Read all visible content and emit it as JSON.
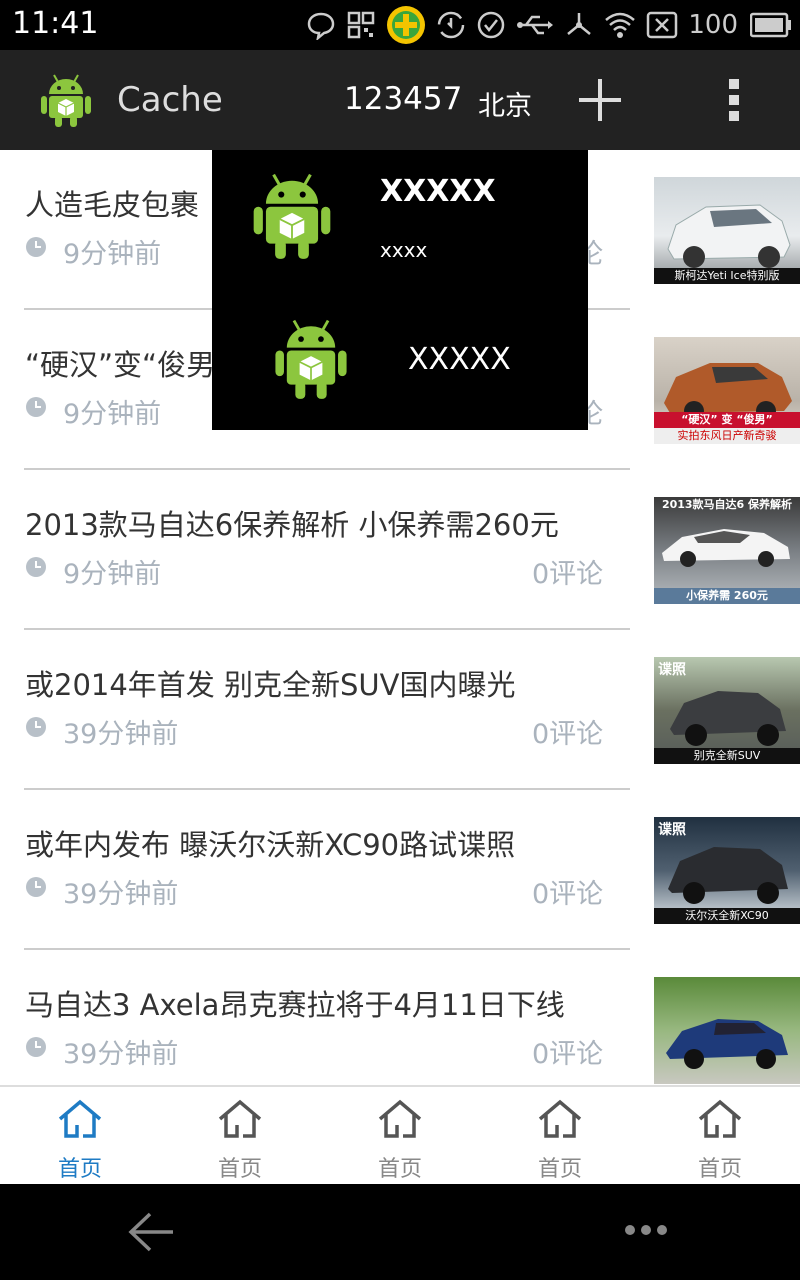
{
  "status_bar": {
    "time": "11:41",
    "battery_level": "100",
    "icons": [
      "chat-bubble-icon",
      "qr-icon",
      "security-plus-icon",
      "sync-icon",
      "check-icon",
      "usb-icon",
      "debug-icon",
      "wifi-icon",
      "sim-off-icon",
      "battery-icon"
    ]
  },
  "action_bar": {
    "title": "Cache",
    "city_code": "123457",
    "city_name": "北京",
    "icons": [
      "android-logo-icon",
      "plus-icon",
      "overflow-menu-icon"
    ]
  },
  "news": {
    "items": [
      {
        "title": "人造毛皮包裹",
        "time": "9分钟前",
        "comments": "0评论",
        "thumb_caption": "斯柯达Yeti Ice特别版",
        "thumb_tag": ""
      },
      {
        "title": "“硬汉”变“俊男",
        "time": "9分钟前",
        "comments": "0评论",
        "thumb_caption": "实拍东风日产新奇骏",
        "thumb_tag": "“硬汉” 变 “俊男”"
      },
      {
        "title": "2013款马自达6保养解析 小保养需260元",
        "time": "9分钟前",
        "comments": "0评论",
        "thumb_caption": "小保养需 260元",
        "thumb_tag": "2013款马自达6 保养解析"
      },
      {
        "title": "或2014年首发 别克全新SUV国内曝光",
        "time": "39分钟前",
        "comments": "0评论",
        "thumb_caption": "别克全新SUV",
        "thumb_tag": "谍照"
      },
      {
        "title": "或年内发布 曝沃尔沃新XC90路试谍照",
        "time": "39分钟前",
        "comments": "0评论",
        "thumb_caption": "沃尔沃全新XC90",
        "thumb_tag": "谍照"
      },
      {
        "title": "马自达3 Axela昂克赛拉将于4月11日下线",
        "time": "39分钟前",
        "comments": "0评论",
        "thumb_caption": "",
        "thumb_tag": ""
      }
    ]
  },
  "popup": {
    "item1_title": "XXXXX",
    "item1_subtitle": "xxxx",
    "item2_label": "XXXXX"
  },
  "tabs": [
    {
      "label": "首页",
      "active": true
    },
    {
      "label": "首页",
      "active": false
    },
    {
      "label": "首页",
      "active": false
    },
    {
      "label": "首页",
      "active": false
    },
    {
      "label": "首页",
      "active": false
    }
  ],
  "colors": {
    "action_bar_bg": "#222222",
    "accent": "#1e7bc4",
    "android_green": "#8cc63e",
    "meta_text": "#aab3bd"
  }
}
